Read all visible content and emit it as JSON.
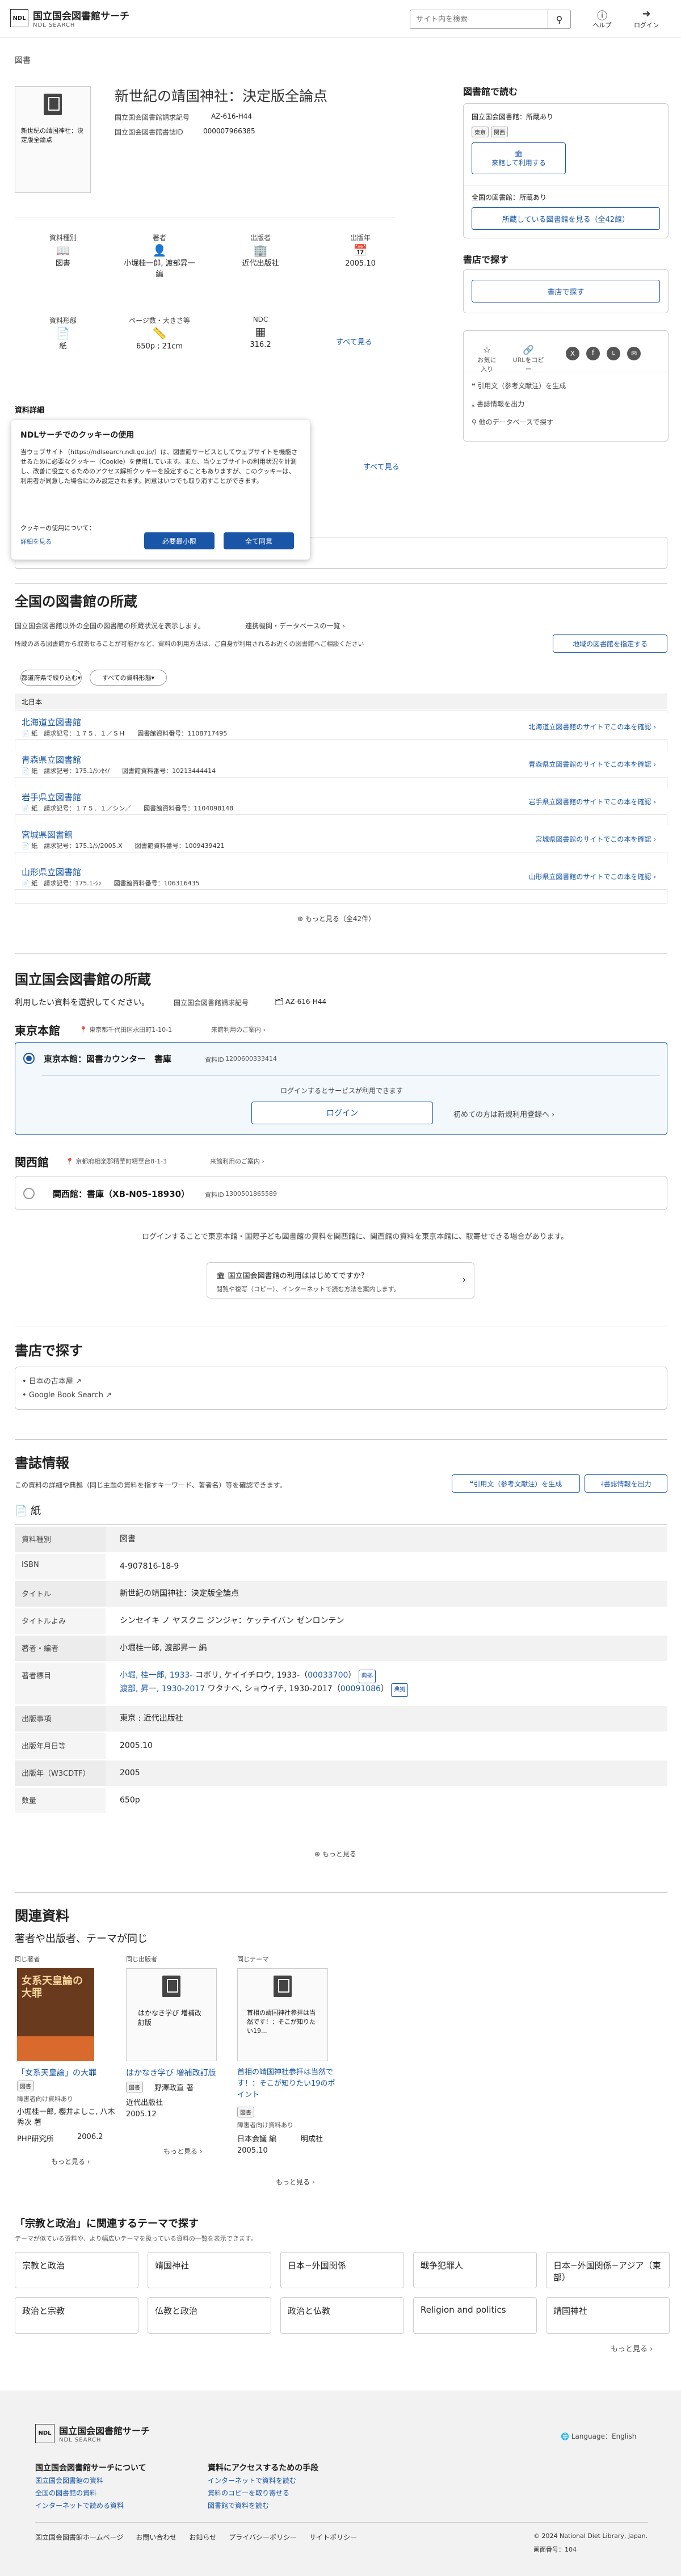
{
  "header": {
    "logo_main": "国立国会図書館サーチ",
    "logo_sub": "NDL SEARCH",
    "logo_mark": "NDL",
    "search_placeholder": "サイト内を検索",
    "help": "ヘルプ",
    "login": "ログイン"
  },
  "section_label": "図書",
  "book": {
    "title": "新世紀の靖国神社：決定版全論点",
    "id_label": "国立国会図書館請求記号",
    "id_value": "AZ-616-H44",
    "num_label": "国立国会図書館書誌ID",
    "num_value": "000007966385",
    "thumb_caption": "新世紀の靖国神社：決定版全論点"
  },
  "meta": [
    {
      "label": "資料種別",
      "icon": "book-icon",
      "value": "図書"
    },
    {
      "label": "著者",
      "icon": "person-icon",
      "value": "小堀桂一郎, 渡部昇一 編"
    },
    {
      "label": "出版者",
      "icon": "building-icon",
      "value": "近代出版社"
    },
    {
      "label": "出版年",
      "icon": "calendar-icon",
      "value": "2005.10"
    },
    {
      "label": "資料形態",
      "icon": "paper-icon",
      "value": "紙"
    },
    {
      "label": "ページ数・大きさ等",
      "icon": "ruler-icon",
      "value": "650p ; 21cm"
    },
    {
      "label": "NDC",
      "icon": "grid-icon",
      "value": "316.2"
    }
  ],
  "see_all": "すべて見る",
  "detail_label": "資料詳細",
  "right": {
    "read_title": "図書館で読む",
    "ndl_label": "国立国会図書館：所蔵あり",
    "tags": [
      "東京",
      "関西"
    ],
    "visit_btn": "来館して利用する",
    "all_label": "全国の図書館：所蔵あり",
    "all_btn": "所蔵している図書館を見る（全42館）",
    "shop_title": "書店で探す",
    "shop_btn": "書店で探す",
    "share": [
      "お気に入り",
      "URLをコピー",
      "X",
      "Facebook",
      "LINE",
      "メール"
    ],
    "links": [
      "引用文（参考文献注）を生成",
      "書誌情報を出力",
      "他のデータベースで探す"
    ]
  },
  "cookie": {
    "title": "NDLサーチでのクッキーの使用",
    "body": "当ウェブサイト（https://ndlsearch.ndl.go.jp/）は、図書館サービスとしてウェブサイトを機能させるために必要なクッキー（Cookie）を使用しています。また、当ウェブサイトの利用状況を計測し、改善に役立てるためのアクセス解析クッキーを設定することもありますが、このクッキーは、利用者が同意した場合にのみ設定されます。同意はいつでも取り消すことができます。",
    "usage": "クッキーの使用について：",
    "detail": "詳細を見る",
    "necessary": "必要最小限",
    "agree": "全て同意"
  },
  "national": {
    "title": "全国の図書館の所蔵",
    "desc": "国立国会図書館以外の全国の図書館の所蔵状況を表示します。",
    "desc_link": "連携機関・データベースの一覧",
    "note": "所蔵のある図書館から取寄せることが可能かなど、資料の利用方法は、ご自身が利用されるお近くの図書館へご相談ください",
    "btn": "地域の図書館を指定する",
    "filter1": "都道府県で絞り込む",
    "filter2": "すべての資料形態",
    "region": "北日本",
    "libs": [
      {
        "name": "北海道立図書館",
        "form": "紙",
        "call": "１７５．１／ＳＨ",
        "num": "1108717495",
        "link": "北海道立図書館のサイトでこの本を確認"
      },
      {
        "name": "青森県立図書館",
        "form": "紙",
        "call": "175.1/ｼﾝｾｲ/",
        "num": "10213444414",
        "link": "青森県立図書館のサイトでこの本を確認"
      },
      {
        "name": "岩手県立図書館",
        "form": "紙",
        "call": "１７５．１／シン／",
        "num": "1104098148",
        "link": "岩手県立図書館のサイトでこの本を確認"
      },
      {
        "name": "宮城県図書館",
        "form": "紙",
        "call": "175.1/ｼ/2005.X",
        "num": "1009439421",
        "link": "宮城県図書館のサイトでこの本を確認"
      },
      {
        "name": "山形県立図書館",
        "form": "紙",
        "call": "175.1-ｼﾝ",
        "num": "106316435",
        "link": "山形県立図書館のサイトでこの本を確認"
      }
    ],
    "call_label": "請求記号",
    "num_label": "図書館資料番号",
    "more": "もっと見る（全42件）"
  },
  "ndl": {
    "title": "国立国会図書館の所蔵",
    "desc": "利用したい資料を選択してください。",
    "id_label": "国立国会図書館請求記号",
    "id_value": "AZ-616-H44",
    "tokyo": {
      "name": "東京本館",
      "addr": "東京都千代田区永田町1-10-1",
      "guide": "来館利用のご案内",
      "item": "東京本館：図書カウンター　書庫",
      "item_id_label": "資料ID",
      "item_id": "1200600333414",
      "login_note": "ログインするとサービスが利用できます",
      "login_btn": "ログイン",
      "register": "初めての方は新規利用登録へ"
    },
    "kansai": {
      "name": "関西館",
      "addr": "京都府相楽郡精華町精華台8-1-3",
      "guide": "来館利用のご案内",
      "item": "関西館：書庫（XB-N05-18930）",
      "item_id_label": "資料ID",
      "item_id": "1300501865589"
    },
    "login_note2": "ログインすることで東京本館・国際子ども図書館の資料を関西館に、関西館の資料を東京本館に、取寄せできる場合があります。",
    "first_time_title": "国立国会図書館の利用ははじめてですか？",
    "first_time_desc": "閲覧や複写（コピー）、インターネットで読む方法を案内します。"
  },
  "bookstore": {
    "title": "書店で探す",
    "links": [
      "日本の古本屋",
      "Google Book Search"
    ]
  },
  "biblio": {
    "title": "書誌情報",
    "desc": "この資料の詳細や典拠（同じ主題の資料を指すキーワード、著者名）等を確認できます。",
    "cite_btn": "引用文（参考文献注）を生成",
    "export_btn": "書誌情報を出力",
    "form": "紙",
    "rows": [
      {
        "k": "資料種別",
        "v": "図書"
      },
      {
        "k": "ISBN",
        "v": "4-907816-18-9"
      },
      {
        "k": "タイトル",
        "v": "新世紀の靖国神社：決定版全論点"
      },
      {
        "k": "タイトルよみ",
        "v": "シンセイキ ノ ヤスクニ ジンジャ：ケッテイバン ゼンロンテン"
      },
      {
        "k": "著者・編者",
        "v": "小堀桂一郎, 渡部昇一 編"
      },
      {
        "k": "著者標目",
        "v1": "小堀, 桂一郎, 1933-",
        "v1b": "コボリ, ケイイチロウ, 1933-（",
        "v1id": "00033700",
        "v2": "渡部, 昇一, 1930-2017",
        "v2b": "ワタナベ, ショウイチ, 1930-2017（",
        "v2id": "00091086",
        "auth": "典拠"
      },
      {
        "k": "出版事項",
        "v": "東京 : 近代出版社"
      },
      {
        "k": "出版年月日等",
        "v": "2005.10"
      },
      {
        "k": "出版年（W3CDTF）",
        "v": "2005"
      },
      {
        "k": "数量",
        "v": "650p"
      }
    ],
    "more": "もっと見る"
  },
  "related": {
    "title": "関連資料",
    "sub": "著者や出版者、テーマが同じ",
    "cols": [
      {
        "label": "同じ著者",
        "title": "「女系天皇論」の大罪",
        "type": "図書",
        "note": "障害者向け資料あり",
        "author": "小堀桂一郎, 櫻井よしこ, 八木秀次 著",
        "pub": "PHP研究所",
        "year": "2006.2",
        "more": "もっと見る",
        "cover": "女系天皇論の大罪"
      },
      {
        "label": "同じ出版者",
        "title": "はかなき学び 増補改訂版",
        "type": "図書",
        "author": "野澤政直 著",
        "pub": "近代出版社",
        "year": "2005.12",
        "more": "もっと見る",
        "thumb": "はかなき学び 増補改訂版"
      },
      {
        "label": "同じテーマ",
        "title": "首相の靖国神社参拝は当然です！：そこが知りたい19のポイント",
        "type": "図書",
        "note": "障害者向け資料あり",
        "author": "日本会議 編",
        "pub": "明成社",
        "year": "2005.10",
        "more": "もっと見る",
        "thumb": "首相の靖国神社参拝は当然です！：そこが知りたい19..."
      }
    ],
    "theme_title": "「宗教と政治」に関連するテーマで探す",
    "theme_desc": "テーマが似ている資料や、より幅広いテーマを扱っている資料の一覧を表示できます。",
    "chips": [
      "宗教と政治",
      "靖国神社",
      "日本−外国関係",
      "戦争犯罪人",
      "日本−外国関係−アジア（東部）",
      "政治と宗教",
      "仏教と政治",
      "政治と仏教",
      "Religion and politics",
      "靖国神社"
    ],
    "more": "もっと見る"
  },
  "footer": {
    "lang": "Language：English",
    "about_title": "国立国会図書館サーチについて",
    "about": [
      "国立国会図書館の資料",
      "全国の図書館の資料",
      "インターネットで読める資料"
    ],
    "access_title": "資料にアクセスするための手段",
    "access": [
      "インターネットで資料を読む",
      "資料のコピーを取り寄せる",
      "図書館で資料を読む"
    ],
    "bottom": [
      "国立国会図書館ホームページ",
      "お問い合わせ",
      "お知らせ",
      "プライバシーポリシー",
      "サイトポリシー"
    ],
    "copy": "© 2024 National Diet Library, Japan.",
    "ver_label": "画面番号",
    "ver": "104"
  }
}
